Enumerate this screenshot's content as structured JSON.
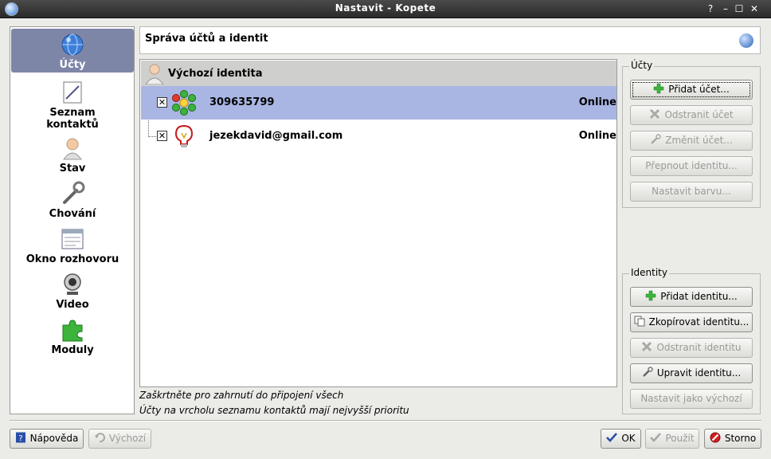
{
  "window": {
    "title": "Nastavit - Kopete",
    "controls": [
      "?",
      "–",
      "☐",
      "✕"
    ]
  },
  "sidebar": {
    "items": [
      {
        "label": "Účty",
        "icon": "globe-icon"
      },
      {
        "label": "Seznam kontaktů",
        "icon": "contact-list-icon"
      },
      {
        "label": "Stav",
        "icon": "person-icon"
      },
      {
        "label": "Chování",
        "icon": "wrench-icon"
      },
      {
        "label": "Okno rozhovoru",
        "icon": "chat-window-icon"
      },
      {
        "label": "Video",
        "icon": "webcam-icon"
      },
      {
        "label": "Moduly",
        "icon": "puzzle-icon"
      }
    ],
    "selected": "Účty"
  },
  "header": {
    "title": "Správa účtů a identit"
  },
  "accounts_tree": {
    "group": "Výchozí identita",
    "rows": [
      {
        "account": "309635799",
        "status": "Online",
        "checked": true,
        "protocol": "icq-flower-icon"
      },
      {
        "account": "jezekdavid@gmail.com",
        "status": "Online",
        "checked": true,
        "protocol": "jabber-bulb-icon"
      }
    ]
  },
  "hints": {
    "line1": "Zaškrtněte pro zahrnutí do připojení všech",
    "line2": "Účty na vrcholu seznamu kontaktů mají nejvyšší prioritu"
  },
  "accounts_box": {
    "label": "Účty",
    "buttons": [
      {
        "label": "Přidat účet...",
        "enabled": true
      },
      {
        "label": "Odstranit účet",
        "enabled": false
      },
      {
        "label": "Změnit účet...",
        "enabled": false
      },
      {
        "label": "Přepnout identitu...",
        "enabled": false
      },
      {
        "label": "Nastavit barvu...",
        "enabled": false
      }
    ]
  },
  "identities_box": {
    "label": "Identity",
    "buttons": [
      {
        "label": "Přidat identitu...",
        "enabled": true
      },
      {
        "label": "Zkopírovat identitu...",
        "enabled": true
      },
      {
        "label": "Odstranit identitu",
        "enabled": false
      },
      {
        "label": "Upravit identitu...",
        "enabled": true
      },
      {
        "label": "Nastavit jako výchozí",
        "enabled": false
      }
    ]
  },
  "footer": {
    "help": "Nápověda",
    "defaults": "Výchozí",
    "ok": "OK",
    "apply": "Použít",
    "cancel": "Storno"
  }
}
